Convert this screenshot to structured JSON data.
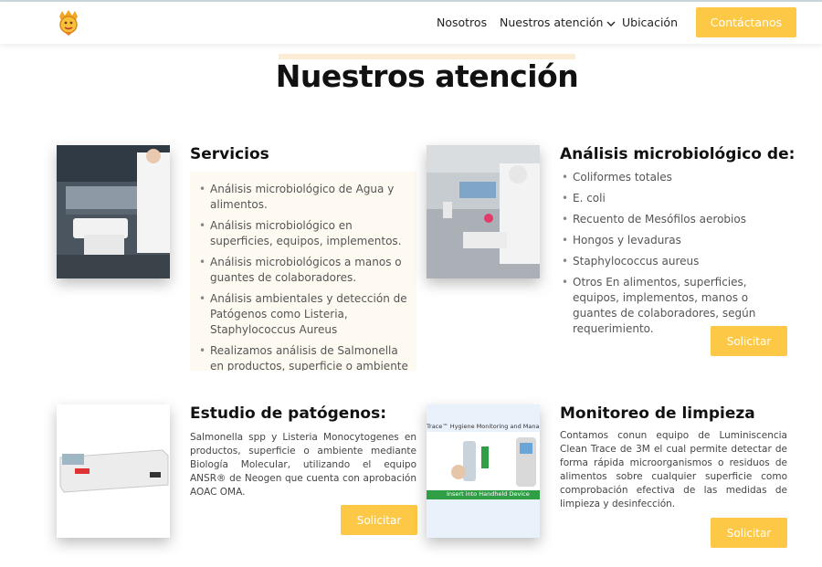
{
  "header": {
    "nav": {
      "nosotros": "Nosotros",
      "atencion": "Nuestros atención",
      "ubicacion": "Ubicación"
    },
    "cta_label": "Contáctanos"
  },
  "page_title": "Nuestros atención",
  "services": {
    "title": "Servicios",
    "items": [
      "Análisis microbiológico de Agua y alimentos.",
      "Análisis microbiológico en superficies, equipos, implementos.",
      "Análisis microbiológicos a manos o guantes de colaboradores.",
      "Análisis ambientales y detección de Patógenos como Listeria, Staphylococcus Aureus",
      "Realizamos análisis de Salmonella en productos, superficie o ambiente"
    ]
  },
  "microbiology": {
    "title": "Análisis microbiológico de:",
    "items": [
      "Coliformes totales",
      "E. coli",
      "Recuento de Mesófilos aerobios",
      "Hongos y levaduras",
      "Staphylococcus aureus",
      "Otros En alimentos, superficies, equipos, implementos, manos o guantes de colaboradores, según requerimiento."
    ],
    "button_label": "Solicitar"
  },
  "pathogens": {
    "title": "Estudio de patógenos:",
    "text": "Salmonella spp y Listeria Monocytogenes en productos, superficie o ambiente mediante Biología Molecular, utilizando el equipo ANSR® de Neogen que cuenta con aprobación AOAC OMA.",
    "button_label": "Solicitar"
  },
  "cleaning": {
    "title": "Monitoreo de limpieza",
    "text": "Contamos conun equipo de Luminiscencia Clean Trace de 3M el cual permite detectar de forma rápida microorganismos o residuos de alimentos sobre cualquier superficie como comprobación efectiva de las medidas de limpieza y desinfección.",
    "button_label": "Solicitar",
    "image_caption": "Trace™ Hygiene Monitoring and Managem",
    "image_subcaption": "Insert into Handheld Device"
  },
  "colors": {
    "accent": "#fcc845",
    "title_highlight": "#fdecd5",
    "service_box_bg": "#fefaf1"
  }
}
